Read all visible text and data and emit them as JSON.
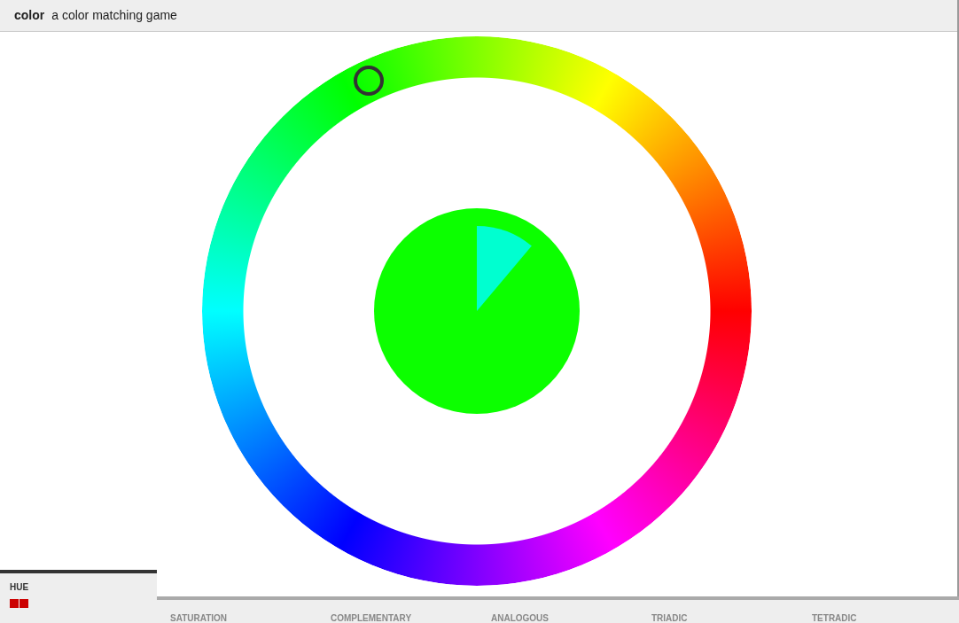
{
  "header": {
    "title": "color",
    "subtitle": "a color matching game"
  },
  "wheel": {
    "handle": {
      "level": 0.32
    },
    "disc": {
      "color": "#0cff00"
    },
    "wedge": {
      "color": "#00ffd0"
    }
  },
  "tabs": [
    {
      "label": "HUE",
      "selected": true,
      "marks": [
        {
          "color": "#cc0000"
        },
        {
          "color": "#cc0000"
        }
      ]
    },
    {
      "label": "SATURATION",
      "selected": false
    },
    {
      "label": "COMPLEMENTARY",
      "selected": false
    },
    {
      "label": "ANALOGOUS",
      "selected": false
    },
    {
      "label": "TRIADIC",
      "selected": false
    },
    {
      "label": "TETRADIC",
      "selected": false
    }
  ]
}
